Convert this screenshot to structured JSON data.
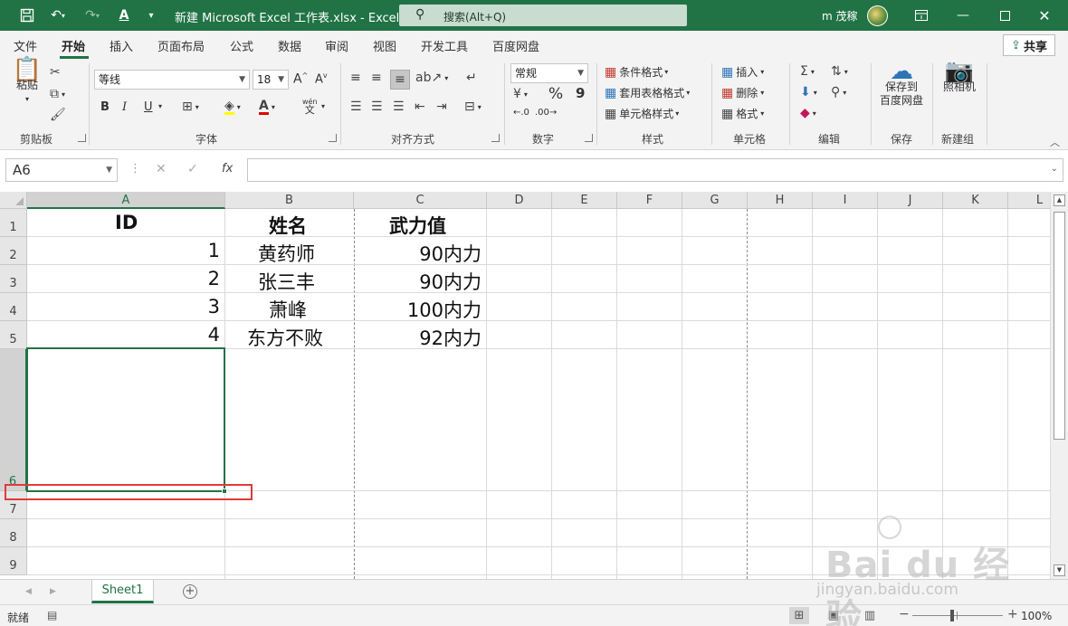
{
  "titlebar": {
    "title": "新建 Microsoft Excel 工作表.xlsx  -  Excel",
    "search": "搜索(Alt+Q)",
    "user": "m 茂稼",
    "bg_color": "#217346"
  },
  "menu": {
    "tabs": [
      "文件",
      "开始",
      "插入",
      "页面布局",
      "公式",
      "数据",
      "审阅",
      "视图",
      "开发工具",
      "百度网盘"
    ],
    "active": "开始",
    "share": "共享"
  },
  "ribbon": {
    "clipboard": {
      "paste": "粘贴",
      "label": "剪贴板"
    },
    "font": {
      "name": "等线",
      "size": "18",
      "bold": "B",
      "italic": "I",
      "underline": "U",
      "phonetic": "wén",
      "label": "字体"
    },
    "alignment": {
      "label": "对齐方式"
    },
    "number": {
      "format": "常规",
      "percent": "%",
      "comma": "9",
      "label": "数字"
    },
    "styles": {
      "conditional": "条件格式",
      "table": "套用表格格式",
      "cell": "单元格样式",
      "label": "样式"
    },
    "cells": {
      "insert": "插入",
      "delete": "删除",
      "format": "格式",
      "label": "单元格"
    },
    "editing": {
      "label": "编辑"
    },
    "save": {
      "button": "保存到\n百度网盘",
      "label": "保存"
    },
    "camera": {
      "button": "照相机",
      "label": "新建组"
    }
  },
  "formula_bar": {
    "name_box": "A6",
    "fx": "fx",
    "value": ""
  },
  "grid": {
    "columns": [
      "A",
      "B",
      "C",
      "D",
      "E",
      "F",
      "G",
      "H",
      "I",
      "J",
      "K",
      "L"
    ],
    "rows": [
      "1",
      "2",
      "3",
      "4",
      "5",
      "6",
      "7",
      "8",
      "9"
    ],
    "header": [
      "ID",
      "姓名",
      "武力值"
    ],
    "data": [
      [
        "1",
        "黄药师",
        "90内力"
      ],
      [
        "2",
        "张三丰",
        "90内力"
      ],
      [
        "3",
        "萧峰",
        "100内力"
      ],
      [
        "4",
        "东方不败",
        "92内力"
      ]
    ]
  },
  "sheets": {
    "tabs": [
      "Sheet1"
    ],
    "add": "+"
  },
  "status": {
    "text": "就绪",
    "zoom": "100%"
  },
  "watermark": {
    "logo": "Bai du 经验",
    "url": "jingyan.baidu.com"
  }
}
